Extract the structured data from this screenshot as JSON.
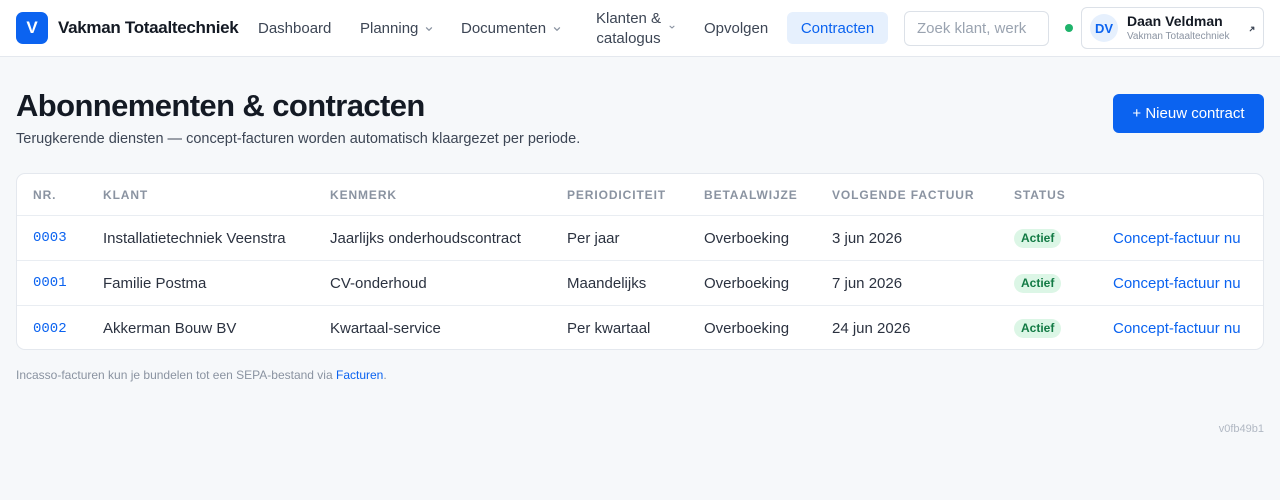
{
  "brand": {
    "logo_letter": "V",
    "name": "Vakman Totaaltechniek"
  },
  "nav": {
    "dashboard": "Dashboard",
    "planning": "Planning",
    "documenten": "Documenten",
    "klanten_line1": "Klanten &",
    "klanten_line2": "catalogus",
    "opvolgen": "Opvolgen",
    "contracten": "Contracten"
  },
  "search": {
    "placeholder": "Zoek klant, werk"
  },
  "user": {
    "initials": "DV",
    "name": "Daan Veldman",
    "org": "Vakman Totaaltechniek"
  },
  "page": {
    "title": "Abonnementen & contracten",
    "subtitle": "Terugkerende diensten — concept-facturen worden automatisch klaargezet per periode.",
    "new_button": "+ Nieuw contract"
  },
  "table": {
    "headers": {
      "nr": "NR.",
      "klant": "KLANT",
      "kenmerk": "KENMERK",
      "periodiciteit": "PERIODICITEIT",
      "betaalwijze": "BETAALWIJZE",
      "volgende": "VOLGENDE FACTUUR",
      "status": "STATUS"
    },
    "rows": [
      {
        "nr": "0003",
        "klant": "Installatietechniek Veenstra",
        "kenmerk": "Jaarlijks onderhoudscontract",
        "periodiciteit": "Per jaar",
        "betaalwijze": "Overboeking",
        "volgende": "3 jun 2026",
        "status": "Actief",
        "action": "Concept-factuur nu"
      },
      {
        "nr": "0001",
        "klant": "Familie Postma",
        "kenmerk": "CV-onderhoud",
        "periodiciteit": "Maandelijks",
        "betaalwijze": "Overboeking",
        "volgende": "7 jun 2026",
        "status": "Actief",
        "action": "Concept-factuur nu"
      },
      {
        "nr": "0002",
        "klant": "Akkerman Bouw BV",
        "kenmerk": "Kwartaal-service",
        "periodiciteit": "Per kwartaal",
        "betaalwijze": "Overboeking",
        "volgende": "24 jun 2026",
        "status": "Actief",
        "action": "Concept-factuur nu"
      }
    ]
  },
  "footer": {
    "note_prefix": "Incasso-facturen kun je bundelen tot een SEPA-bestand via ",
    "note_link": "Facturen",
    "note_suffix": ".",
    "version": "v0fb49b1"
  },
  "colors": {
    "accent": "#0b63f0",
    "status_active_bg": "#dcf6e6",
    "status_active_text": "#127a44",
    "online_dot": "#1fb36b"
  },
  "icons": {
    "nav_dropdown": "chevron-down-icon",
    "user_menu": "chevron-up-right-icon",
    "online": "status-dot-icon"
  }
}
